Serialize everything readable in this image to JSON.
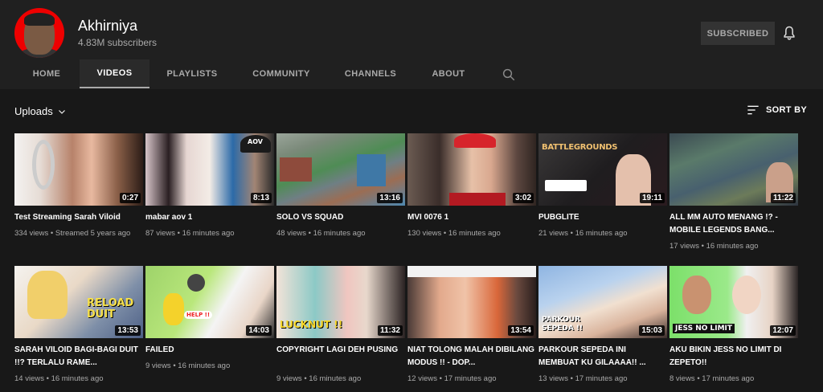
{
  "channel": {
    "name": "Akhirniya",
    "subscribers": "4.83M subscribers",
    "subscribe_label": "SUBSCRIBED"
  },
  "tabs": [
    {
      "label": "HOME"
    },
    {
      "label": "VIDEOS"
    },
    {
      "label": "PLAYLISTS"
    },
    {
      "label": "COMMUNITY"
    },
    {
      "label": "CHANNELS"
    },
    {
      "label": "ABOUT"
    }
  ],
  "active_tab": "VIDEOS",
  "uploads_label": "Uploads",
  "sort_label": "SORT BY",
  "videos": [
    {
      "title": "Test Streaming Sarah Viloid",
      "meta": "334 views • Streamed 5 years ago",
      "duration": "0:27",
      "thumb_text": ""
    },
    {
      "title": "mabar aov 1",
      "meta": "87 views • 16 minutes ago",
      "duration": "8:13",
      "thumb_text": "AOV"
    },
    {
      "title": "SOLO VS SQUAD",
      "meta": "48 views • 16 minutes ago",
      "duration": "13:16",
      "thumb_text": ""
    },
    {
      "title": "MVI 0076 1",
      "meta": "130 views • 16 minutes ago",
      "duration": "3:02",
      "thumb_text": ""
    },
    {
      "title": "PUBGLITE",
      "meta": "21 views • 16 minutes ago",
      "duration": "19:11",
      "thumb_text": "BATTLEGROUNDS"
    },
    {
      "title": "ALL MM AUTO MENANG !? - MOBILE LEGENDS BANG...",
      "meta": "17 views • 16 minutes ago",
      "duration": "11:22",
      "thumb_text": ""
    },
    {
      "title": "SARAH VILOID BAGI-BAGI DUIT !!? TERLALU RAME...",
      "meta": "14 views • 16 minutes ago",
      "duration": "13:53",
      "thumb_text": "RELOAD DUIT"
    },
    {
      "title": "FAILED",
      "meta": "9 views • 16 minutes ago",
      "duration": "14:03",
      "thumb_text": "HELP !!"
    },
    {
      "title": "COPYRIGHT LAGI DEH PUSING",
      "meta": "9 views • 16 minutes ago",
      "duration": "11:32",
      "thumb_text": "LUCKNUT !!"
    },
    {
      "title": "NIAT TOLONG MALAH DIBILANG MODUS !! - DOP...",
      "meta": "12 views • 17 minutes ago",
      "duration": "13:54",
      "thumb_text": ""
    },
    {
      "title": "PARKOUR SEPEDA INI MEMBUAT KU GILAAAA!! ...",
      "meta": "13 views • 17 minutes ago",
      "duration": "15:03",
      "thumb_text": "PARKOUR SEPEDA !!"
    },
    {
      "title": "AKU BIKIN JESS NO LIMIT DI ZEPETO!!",
      "meta": "8 views • 17 minutes ago",
      "duration": "12:07",
      "thumb_text": "JESS NO LIMIT"
    }
  ],
  "colors": {
    "background": "#181818",
    "header": "#202020",
    "avatar_ring": "#e00000"
  }
}
